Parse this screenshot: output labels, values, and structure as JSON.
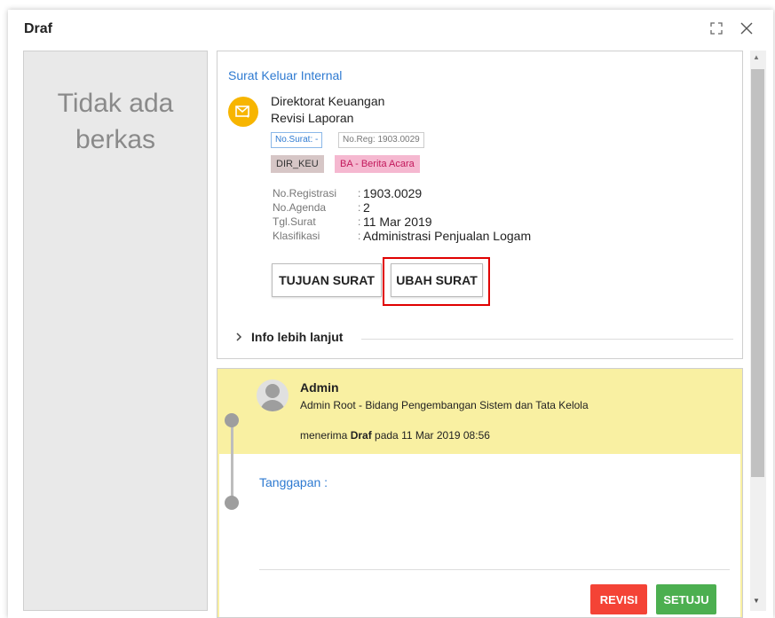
{
  "dialog": {
    "title": "Draf",
    "maximize_icon": "maximize-icon",
    "close_icon": "close-icon"
  },
  "left_panel": {
    "empty_text": "Tidak ada berkas"
  },
  "letter": {
    "header": "Surat Keluar Internal",
    "icon": "mail-icon",
    "from": "Direktorat Keuangan",
    "subject": "Revisi Laporan",
    "tags": {
      "no_surat": "No.Surat: -",
      "no_reg": "No.Reg: 1903.0029",
      "unit": "DIR_KEU",
      "type": "BA - Berita Acara"
    },
    "meta": [
      {
        "label": "No.Registrasi",
        "value": "1903.0029"
      },
      {
        "label": "No.Agenda",
        "value": "2"
      },
      {
        "label": "Tgl.Surat",
        "value": "11 Mar 2019"
      },
      {
        "label": "Klasifikasi",
        "value": "Administrasi Penjualan Logam"
      }
    ],
    "buttons": {
      "tujuan": "TUJUAN SURAT",
      "ubah": "UBAH SURAT"
    },
    "info_more": "Info lebih lanjut"
  },
  "timeline": {
    "user_name": "Admin",
    "user_role": "Admin Root - Bidang Pengembangan Sistem dan Tata Kelola",
    "action_prefix": "menerima ",
    "action_bold": "Draf",
    "action_suffix": " pada 11 Mar 2019 08:56",
    "response_label": "Tanggapan :",
    "buttons": {
      "revisi": "REVISI",
      "setuju": "SETUJU"
    }
  },
  "colors": {
    "accent_blue": "#2e7ad1",
    "mail_icon": "#f7b500",
    "highlight": "#f9f0a2",
    "revisi": "#f44336",
    "setuju": "#4caf50",
    "annotation_box": "#e00000"
  }
}
